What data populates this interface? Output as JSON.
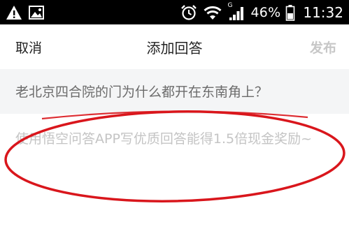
{
  "status_bar": {
    "battery_percent": "46%",
    "time": "11:32",
    "network_type": "G",
    "icons": [
      "warning-icon",
      "image-icon",
      "alarm-icon",
      "wifi-icon",
      "signal-icon",
      "battery-icon"
    ]
  },
  "nav": {
    "cancel_label": "取消",
    "title": "添加回答",
    "publish_label": "发布"
  },
  "question": {
    "text": "老北京四合院的门为什么都开在东南角上？"
  },
  "answer": {
    "placeholder": "使用悟空问答APP写优质回答能得1.5倍现金奖励~"
  },
  "colors": {
    "status_bar_bg": "#000000",
    "question_bg": "#f4f5f6",
    "publish_disabled": "#c7c7c7",
    "placeholder": "#c4c4c4",
    "annotation_red": "#d9161c"
  }
}
